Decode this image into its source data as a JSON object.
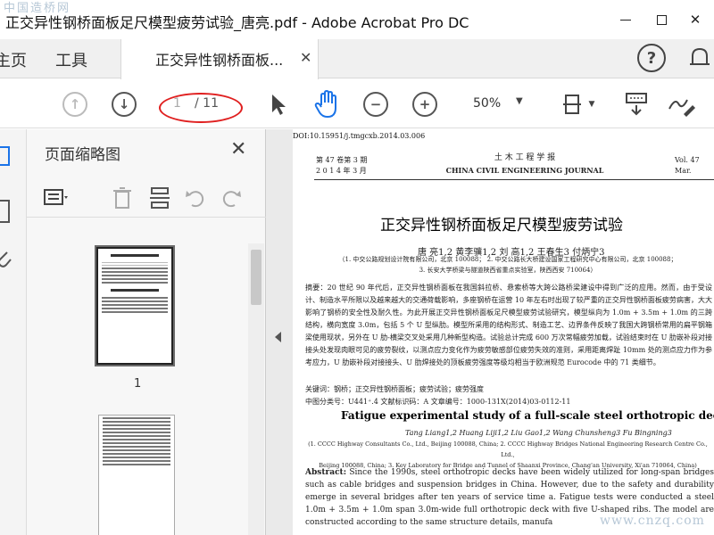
{
  "window": {
    "title": "正交异性钢桥面板足尺模型疲劳试验_唐亮.pdf - Adobe Acrobat Pro DC",
    "watermark_top": "中国造桥网",
    "watermark_bottom": "www.cnzq.com"
  },
  "menubar": {
    "home_label": "主页",
    "tools_label": "工具",
    "tab_label": "正交异性钢桥面板...",
    "help_label": "?"
  },
  "toolbar": {
    "page_current": "1",
    "page_total": "/ 11",
    "zoom": "50%"
  },
  "thumb_panel": {
    "title": "页面缩略图",
    "thumb1_label": "1"
  },
  "document": {
    "doi": "DOI:10.15951/j.tmgcxb.2014.03.006",
    "journal_left_1": "第 47 卷第 3 期",
    "journal_left_2": "2 0 1 4 年 3 月",
    "journal_cn": "土 木 工 程 学 报",
    "journal_en": "CHINA CIVIL ENGINEERING JOURNAL",
    "journal_right_1": "Vol. 47",
    "journal_right_2": "Mar.",
    "cn_title": "正交异性钢桥面板足尺模型疲劳试验",
    "cn_authors": "唐 亮1,2  黄李骥1,2  刘 高1,2  王春生3  付炳宁3",
    "cn_aff_1": "（1. 中交公路规划设计院有限公司，北京 100088；  2. 中交公路长大桥建设国家工程研究中心有限公司，北京 100088；",
    "cn_aff_2": "3. 长安大学桥梁与隧道陕西省重点实验室，陕西西安 710064）",
    "abstract_cn": "摘要：20 世纪 90 年代后，正交异性钢桥面板在我国斜拉桥、悬索桥等大跨公路桥梁建设中得到广泛的应用。然而，由于受设计、制造水平所限以及越来越大的交通荷载影响，多座钢桥在运营 10 年左右时出现了较严重的正交异性钢桥面板疲劳病害，大大影响了钢桥的安全性及耐久性。为此开展正交异性钢桥面板足尺模型疲劳试验研究，模型纵向为 1.0m + 3.5m + 1.0m 的三跨结构，横向宽度 3.0m，包括 5 个 U 型纵肋。模型所采用的结构形式、制造工艺、边界条件反映了我国大跨钢桥常用的扁平钢箱梁使用现状，另外在 U 肋-横梁交叉处采用几种新型构造。试验总计完成 600 万次常幅疲劳加载，试验结束时在 U 肋嵌补段对接接头处发现肉眼可见的疲劳裂纹，以测点应力变化作为疲劳敏感部位疲劳失效的准则，采用距离焊趾 10mm 处的测点应力作为参考应力，U 肋嵌补段对接接头、U 肋焊接处的顶板疲劳强度等级均相当于欧洲规范 Eurocode 中的 71 类细节。",
    "keywords": "关键词：钢桥；正交异性钢桥面板；疲劳试验；疲劳强度",
    "classification": "中图分类号：U441⁺.4      文献标识码：A      文章编号：1000-131X(2014)03-0112-11",
    "en_title": "Fatigue experimental study of a full-scale steel orthotropic deck model",
    "en_authors": "Tang Liang1,2   Huang Liji1,2   Liu Gao1,2   Wang Chunsheng3   Fu Bingning3",
    "en_aff_1": "(1. CCCC Highway Consultants Co., Ltd., Beijing 100088, China; 2. CCCC Highway Bridges National Engineering Research Centre Co., Ltd.,",
    "en_aff_2": "Beijing 100088, China; 3. Key Laboratory for Bridge and Tunnel of Shaanxi Province, Chang'an University, Xi'an 710064, China)",
    "abstract_en_label": "Abstract:",
    "abstract_en": " Since the 1990s, steel orthotropic decks have been widely utilized for long-span bridges such as cable bridges and suspension bridges in China. However, due to the safety and durability emerge in several bridges after ten years of service time a. Fatigue tests were conducted a steel 1.0m + 3.5m + 1.0m span 3.0m-wide full orthotropic deck with five U-shaped ribs. The model are constructed according to the same structure details, manufa"
  }
}
